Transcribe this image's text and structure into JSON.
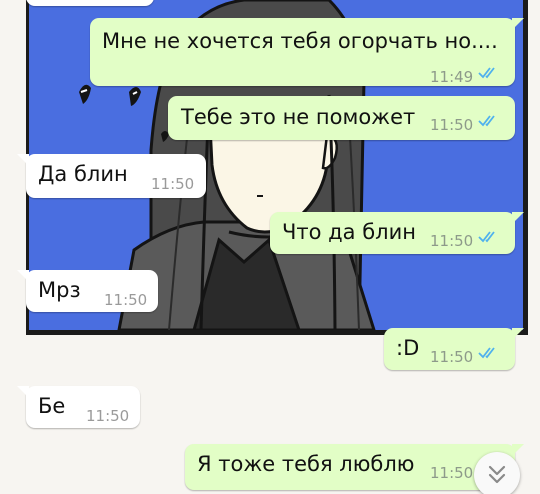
{
  "messages": [
    {
      "direction": "in",
      "text": "",
      "time": ""
    },
    {
      "direction": "out",
      "text": "Мне не хочется тебя огорчать но....",
      "time": "11:49",
      "status": "read"
    },
    {
      "direction": "out",
      "text": "Тебе это не поможет",
      "time": "11:50",
      "status": "read"
    },
    {
      "direction": "in",
      "text": "Да блин",
      "time": "11:50"
    },
    {
      "direction": "out",
      "text": "Что да блин",
      "time": "11:50",
      "status": "read"
    },
    {
      "direction": "in",
      "text": "Мрз",
      "time": "11:50"
    },
    {
      "direction": "out",
      "text": ":D",
      "time": "11:50",
      "status": "read"
    },
    {
      "direction": "in",
      "text": "Бе",
      "time": "11:50"
    },
    {
      "direction": "out",
      "text": "Я тоже тебя люблю",
      "time": "11:50",
      "status": "read"
    }
  ],
  "colors": {
    "outgoing_bubble": "#e2fec6",
    "incoming_bubble": "#ffffff",
    "read_ticks": "#4fb1ee",
    "wallpaper_blue": "#4a6ee0"
  },
  "icons": {
    "read_status": "double-check-icon",
    "scroll_down": "double-chevron-down-icon"
  }
}
